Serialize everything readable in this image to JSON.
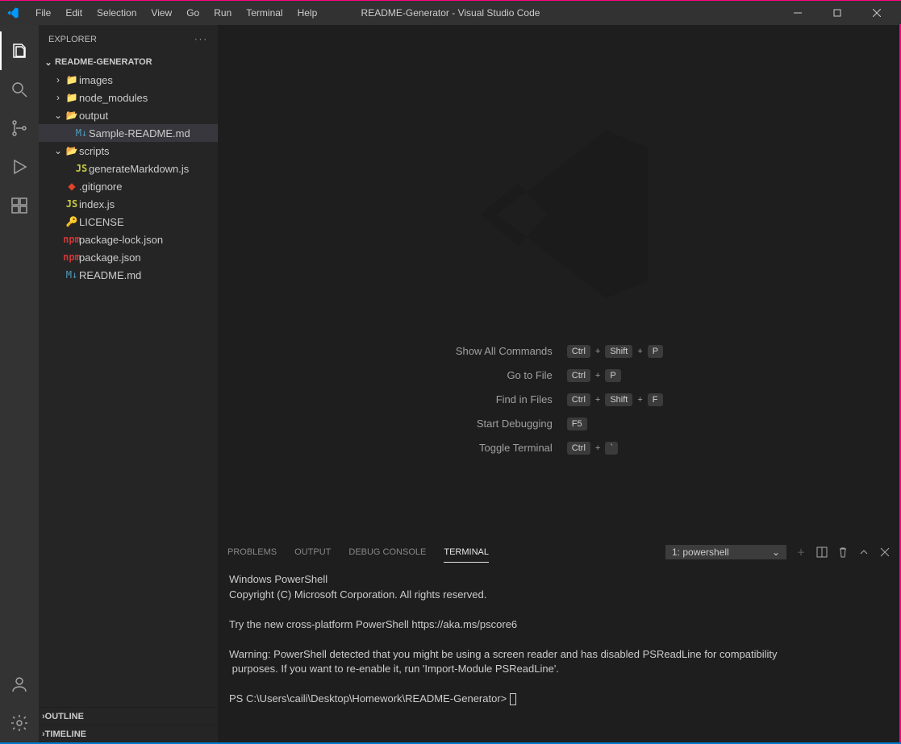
{
  "title": "README-Generator - Visual Studio Code",
  "menu": [
    "File",
    "Edit",
    "Selection",
    "View",
    "Go",
    "Run",
    "Terminal",
    "Help"
  ],
  "explorer": {
    "label": "EXPLORER",
    "project": "README-GENERATOR",
    "tree": [
      {
        "depth": 0,
        "type": "folder",
        "open": false,
        "name": "images"
      },
      {
        "depth": 0,
        "type": "folder",
        "open": false,
        "name": "node_modules"
      },
      {
        "depth": 0,
        "type": "folder",
        "open": true,
        "name": "output"
      },
      {
        "depth": 1,
        "type": "file",
        "icon": "md",
        "name": "Sample-README.md",
        "selected": true
      },
      {
        "depth": 0,
        "type": "folder",
        "open": true,
        "name": "scripts"
      },
      {
        "depth": 1,
        "type": "file",
        "icon": "js",
        "name": "generateMarkdown.js"
      },
      {
        "depth": 0,
        "type": "file",
        "icon": "git",
        "name": ".gitignore"
      },
      {
        "depth": 0,
        "type": "file",
        "icon": "js",
        "name": "index.js"
      },
      {
        "depth": 0,
        "type": "file",
        "icon": "lic",
        "name": "LICENSE"
      },
      {
        "depth": 0,
        "type": "file",
        "icon": "npm",
        "name": "package-lock.json"
      },
      {
        "depth": 0,
        "type": "file",
        "icon": "npm",
        "name": "package.json"
      },
      {
        "depth": 0,
        "type": "file",
        "icon": "md",
        "name": "README.md"
      }
    ],
    "outline": "OUTLINE",
    "timeline": "TIMELINE"
  },
  "shortcuts": [
    {
      "label": "Show All Commands",
      "keys": [
        "Ctrl",
        "Shift",
        "P"
      ]
    },
    {
      "label": "Go to File",
      "keys": [
        "Ctrl",
        "P"
      ]
    },
    {
      "label": "Find in Files",
      "keys": [
        "Ctrl",
        "Shift",
        "F"
      ]
    },
    {
      "label": "Start Debugging",
      "keys": [
        "F5"
      ]
    },
    {
      "label": "Toggle Terminal",
      "keys": [
        "Ctrl",
        "`"
      ]
    }
  ],
  "panel": {
    "tabs": [
      "PROBLEMS",
      "OUTPUT",
      "DEBUG CONSOLE",
      "TERMINAL"
    ],
    "activeTab": "TERMINAL",
    "terminalName": "1: powershell",
    "terminalText": "Windows PowerShell\nCopyright (C) Microsoft Corporation. All rights reserved.\n\nTry the new cross-platform PowerShell https://aka.ms/pscore6\n\nWarning: PowerShell detected that you might be using a screen reader and has disabled PSReadLine for compatibility\n purposes. If you want to re-enable it, run 'Import-Module PSReadLine'.\n\nPS C:\\Users\\caili\\Desktop\\Homework\\README-Generator>"
  }
}
